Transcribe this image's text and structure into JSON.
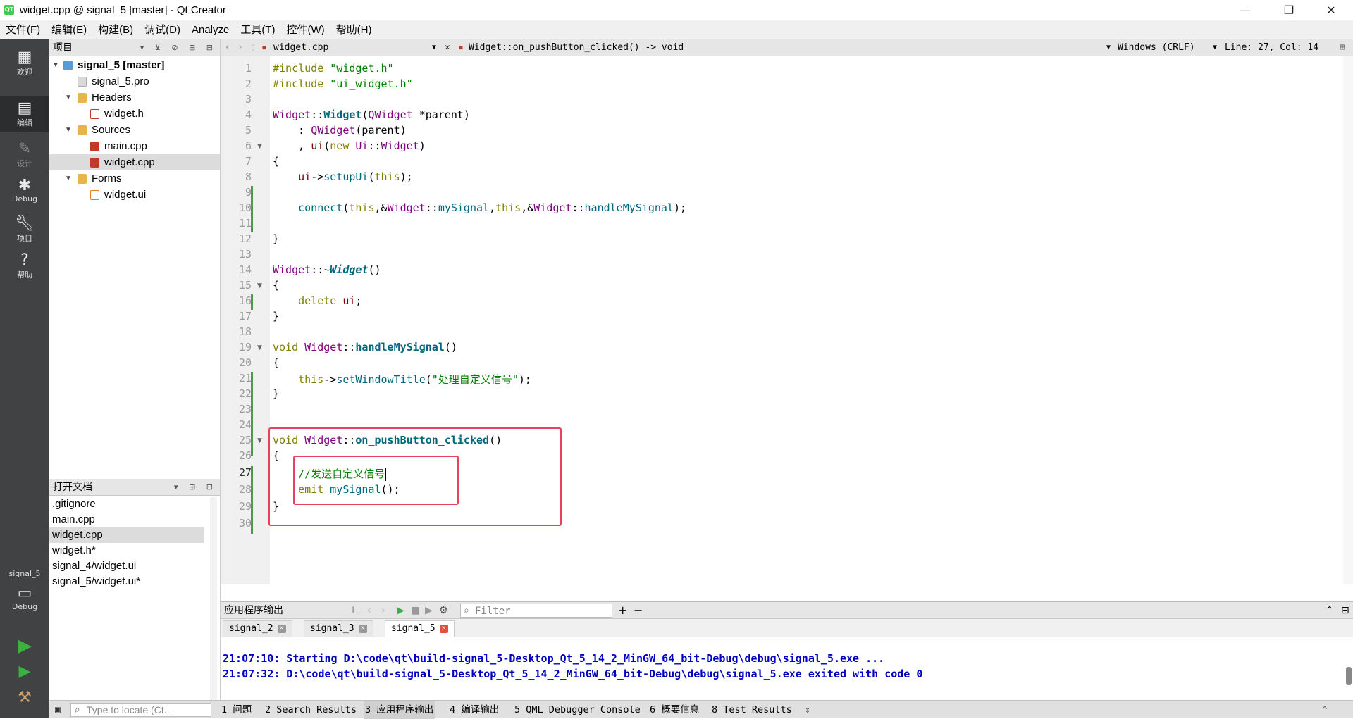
{
  "window": {
    "title": "widget.cpp @ signal_5 [master] - Qt Creator",
    "app_icon": "QT",
    "minimize": "—",
    "restore": "❐",
    "close": "✕"
  },
  "menu": [
    "文件(F)",
    "编辑(E)",
    "构建(B)",
    "调试(D)",
    "Analyze",
    "工具(T)",
    "控件(W)",
    "帮助(H)"
  ],
  "modes": {
    "welcome": "欢迎",
    "edit": "编辑",
    "design": "设计",
    "debug": "Debug",
    "projects": "项目",
    "help": "帮助",
    "kit_name": "signal_5",
    "kit_mode": "Debug"
  },
  "project_panel": {
    "title": "项目"
  },
  "tree": {
    "root": "signal_5 [master]",
    "pro": "signal_5.pro",
    "headers": "Headers",
    "widget_h": "widget.h",
    "sources": "Sources",
    "main_cpp": "main.cpp",
    "widget_cpp": "widget.cpp",
    "forms": "Forms",
    "widget_ui": "widget.ui"
  },
  "open_docs": {
    "title": "打开文档",
    "items": [
      ".gitignore",
      "main.cpp",
      "widget.cpp",
      "widget.h*",
      "signal_4/widget.ui",
      "signal_5/widget.ui*"
    ]
  },
  "editor_toolbar": {
    "file": "widget.cpp",
    "symbol": "Widget::on_pushButton_clicked() -> void",
    "line_ending": "Windows (CRLF)",
    "position": "Line: 27, Col: 14"
  },
  "line_numbers": [
    "1",
    "2",
    "3",
    "4",
    "5",
    "6",
    "7",
    "8",
    "9",
    "10",
    "11",
    "12",
    "13",
    "14",
    "15",
    "16",
    "17",
    "18",
    "19",
    "20",
    "21",
    "22",
    "23",
    "24",
    "25",
    "26",
    "27",
    "28",
    "29",
    "30"
  ],
  "code": {
    "l1a": "#include ",
    "l1b": "\"widget.h\"",
    "l2a": "#include ",
    "l2b": "\"ui_widget.h\"",
    "l4a": "Widget",
    "l4b": "::",
    "l4c": "Widget",
    "l4d": "(",
    "l4e": "QWidget",
    "l4f": " *parent)",
    "l5a": "    : ",
    "l5b": "QWidget",
    "l5c": "(parent)",
    "l6a": "    , ",
    "l6b": "ui",
    "l6c": "(",
    "l6d": "new",
    "l6e": " ",
    "l6f": "Ui",
    "l6g": "::",
    "l6h": "Widget",
    "l6i": ")",
    "l7": "{",
    "l8a": "    ",
    "l8b": "ui",
    "l8c": "->",
    "l8d": "setupUi",
    "l8e": "(",
    "l8f": "this",
    "l8g": ");",
    "l10a": "    ",
    "l10b": "connect",
    "l10c": "(",
    "l10d": "this",
    "l10e": ",&",
    "l10f": "Widget",
    "l10g": "::",
    "l10h": "mySignal",
    "l10i": ",",
    "l10j": "this",
    "l10k": ",&",
    "l10l": "Widget",
    "l10m": "::",
    "l10n": "handleMySignal",
    "l10o": ");",
    "l12": "}",
    "l14a": "Widget",
    "l14b": "::~",
    "l14c": "Widget",
    "l14d": "()",
    "l15": "{",
    "l16a": "    ",
    "l16b": "delete",
    "l16c": " ",
    "l16d": "ui",
    "l16e": ";",
    "l17": "}",
    "l19a": "void",
    "l19b": " ",
    "l19c": "Widget",
    "l19d": "::",
    "l19e": "handleMySignal",
    "l19f": "()",
    "l20": "{",
    "l21a": "    ",
    "l21b": "this",
    "l21c": "->",
    "l21d": "setWindowTitle",
    "l21e": "(",
    "l21f": "\"处理自定义信号\"",
    "l21g": ");",
    "l22": "}",
    "l25a": "void",
    "l25b": " ",
    "l25c": "Widget",
    "l25d": "::",
    "l25e": "on_pushButton_clicked",
    "l25f": "()",
    "l26": "{",
    "l27a": "    ",
    "l27b": "//发送自定义信号",
    "l28a": "    ",
    "l28b": "emit",
    "l28c": " ",
    "l28d": "mySignal",
    "l28e": "();",
    "l29": "}"
  },
  "output": {
    "title": "应用程序输出",
    "filter_placeholder": "Filter",
    "tabs": [
      "signal_2",
      "signal_3",
      "signal_5"
    ],
    "lines": [
      "21:07:10: Starting D:\\code\\qt\\build-signal_5-Desktop_Qt_5_14_2_MinGW_64_bit-Debug\\debug\\signal_5.exe ...",
      "21:07:32: D:\\code\\qt\\build-signal_5-Desktop_Qt_5_14_2_MinGW_64_bit-Debug\\debug\\signal_5.exe exited with code 0"
    ]
  },
  "statusbar": {
    "locate_placeholder": "Type to locate (Ct...",
    "items": [
      "1 问题",
      "2 Search Results",
      "3 应用程序输出",
      "4 编译输出",
      "5 QML Debugger Console",
      "6 概要信息",
      "8 Test Results"
    ]
  },
  "colors": {
    "highlight_box": "#e8415a",
    "mode_bar": "#404244",
    "output_text": "#0000c0"
  }
}
